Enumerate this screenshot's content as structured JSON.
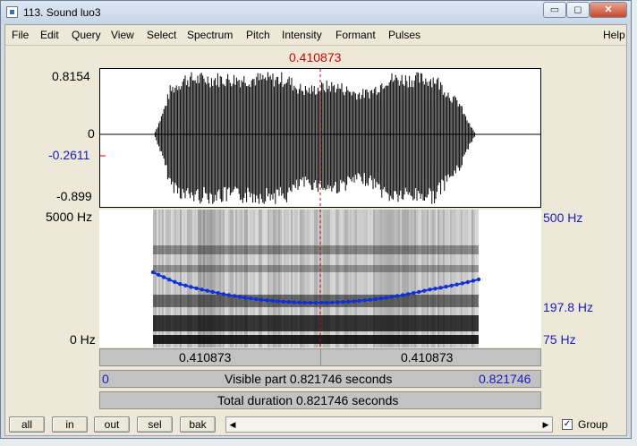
{
  "window": {
    "title": "113. Sound luo3"
  },
  "titlebar_buttons": {
    "minimize": "▭",
    "maximize": "◻",
    "close": "✕"
  },
  "menu": [
    "File",
    "Edit",
    "Query",
    "View",
    "Select",
    "Spectrum",
    "Pitch",
    "Intensity",
    "Formant",
    "Pulses",
    "Help"
  ],
  "cursor": {
    "time_label": "0.410873",
    "position_fraction": 0.5
  },
  "waveform": {
    "max_label": "0.8154",
    "zero_label": "0",
    "cursor_value_label": "-0.2611",
    "min_label": "-0.899"
  },
  "spectrogram": {
    "top_freq_label": "5000 Hz",
    "bottom_freq_label": "0 Hz",
    "pitch_top_label": "500 Hz",
    "pitch_cursor_label": "197.8 Hz",
    "pitch_bottom_label": "75 Hz"
  },
  "info": {
    "left_time": "0.410873",
    "right_time": "0.410873",
    "visible_start": "0",
    "visible_label": "Visible part 0.821746 seconds",
    "visible_end": "0.821746",
    "total_label": "Total duration 0.821746 seconds"
  },
  "bottom_buttons": [
    "all",
    "in",
    "out",
    "sel",
    "bak"
  ],
  "scroll": {
    "left_arrow": "◀",
    "right_arrow": "▶"
  },
  "group": {
    "label": "Group",
    "checked": true,
    "mark": "✓"
  },
  "colors": {
    "cursor": "#d40000",
    "blue_labels": "#1a1abd",
    "pitch_curve": "#1030d8"
  }
}
